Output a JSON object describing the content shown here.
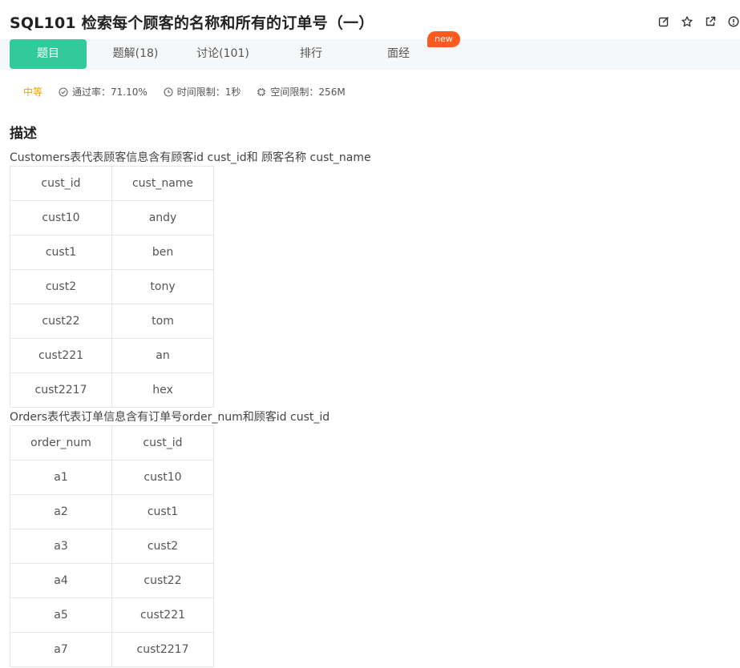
{
  "title": "SQL101  检索每个顾客的名称和所有的订单号（一）",
  "title_actions": [
    {
      "name": "edit-icon"
    },
    {
      "name": "star-icon"
    },
    {
      "name": "share-icon"
    },
    {
      "name": "info-icon"
    }
  ],
  "tabs": [
    {
      "label": "题目"
    },
    {
      "label": "题解(18)"
    },
    {
      "label": "讨论(101)"
    },
    {
      "label": "排行"
    },
    {
      "label": "面经"
    }
  ],
  "new_badge": "new",
  "meta": {
    "difficulty": "中等",
    "pass_rate_label": "通过率：71.10%",
    "time_limit_label": "时间限制：1秒",
    "space_limit_label": "空间限制：256M"
  },
  "section_title": "描述",
  "customers": {
    "description": "Customers表代表顾客信息含有顾客id cust_id和 顾客名称 cust_name",
    "headers": [
      "cust_id",
      "cust_name"
    ],
    "rows": [
      [
        "cust10",
        "andy"
      ],
      [
        "cust1",
        "ben"
      ],
      [
        "cust2",
        "tony"
      ],
      [
        "cust22",
        "tom"
      ],
      [
        "cust221",
        "an"
      ],
      [
        "cust2217",
        "hex"
      ]
    ]
  },
  "orders": {
    "description": "Orders表代表订单信息含有订单号order_num和顾客id cust_id",
    "headers": [
      "order_num",
      "cust_id"
    ],
    "rows": [
      [
        "a1",
        "cust10"
      ],
      [
        "a2",
        "cust1"
      ],
      [
        "a3",
        "cust2"
      ],
      [
        "a4",
        "cust22"
      ],
      [
        "a5",
        "cust221"
      ],
      [
        "a7",
        "cust2217"
      ]
    ]
  },
  "colors": {
    "accent": "#32ca99",
    "badge": "#fe5a1f",
    "difficulty": "#e8a300"
  }
}
